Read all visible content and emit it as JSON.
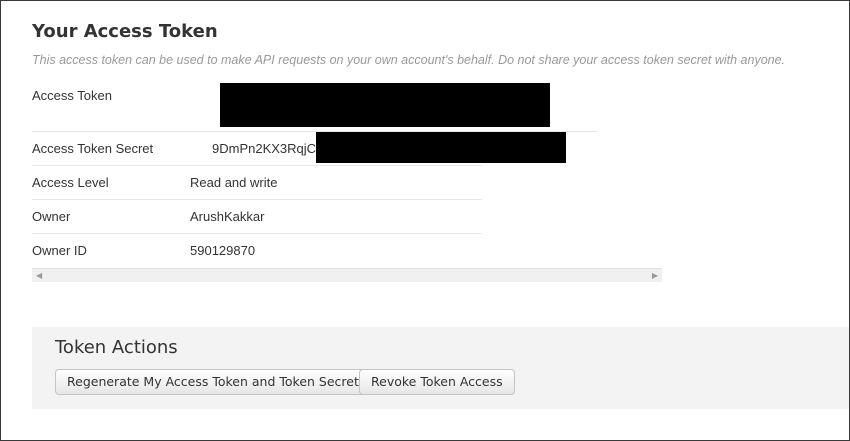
{
  "header": {
    "title": "Your Access Token",
    "description": "This access token can be used to make API requests on your own account's behalf. Do not share your access token secret with anyone."
  },
  "token_table": {
    "rows": [
      {
        "label": "Access Token",
        "value": ""
      },
      {
        "label": "Access Token Secret",
        "value": "9DmPn2KX3RqjC"
      },
      {
        "label": "Access Level",
        "value": "Read and write"
      },
      {
        "label": "Owner",
        "value": "ArushKakkar"
      },
      {
        "label": "Owner ID",
        "value": "590129870"
      }
    ]
  },
  "scrollbar": {
    "left_icon": "arrow-left-icon",
    "right_icon": "arrow-right-icon"
  },
  "token_actions": {
    "title": "Token Actions",
    "regenerate_label": "Regenerate My Access Token and Token Secret",
    "revoke_label": "Revoke Token Access"
  },
  "colors": {
    "redaction": "#000000",
    "actions_bg": "#f3f3f3",
    "muted_text": "#999999"
  }
}
